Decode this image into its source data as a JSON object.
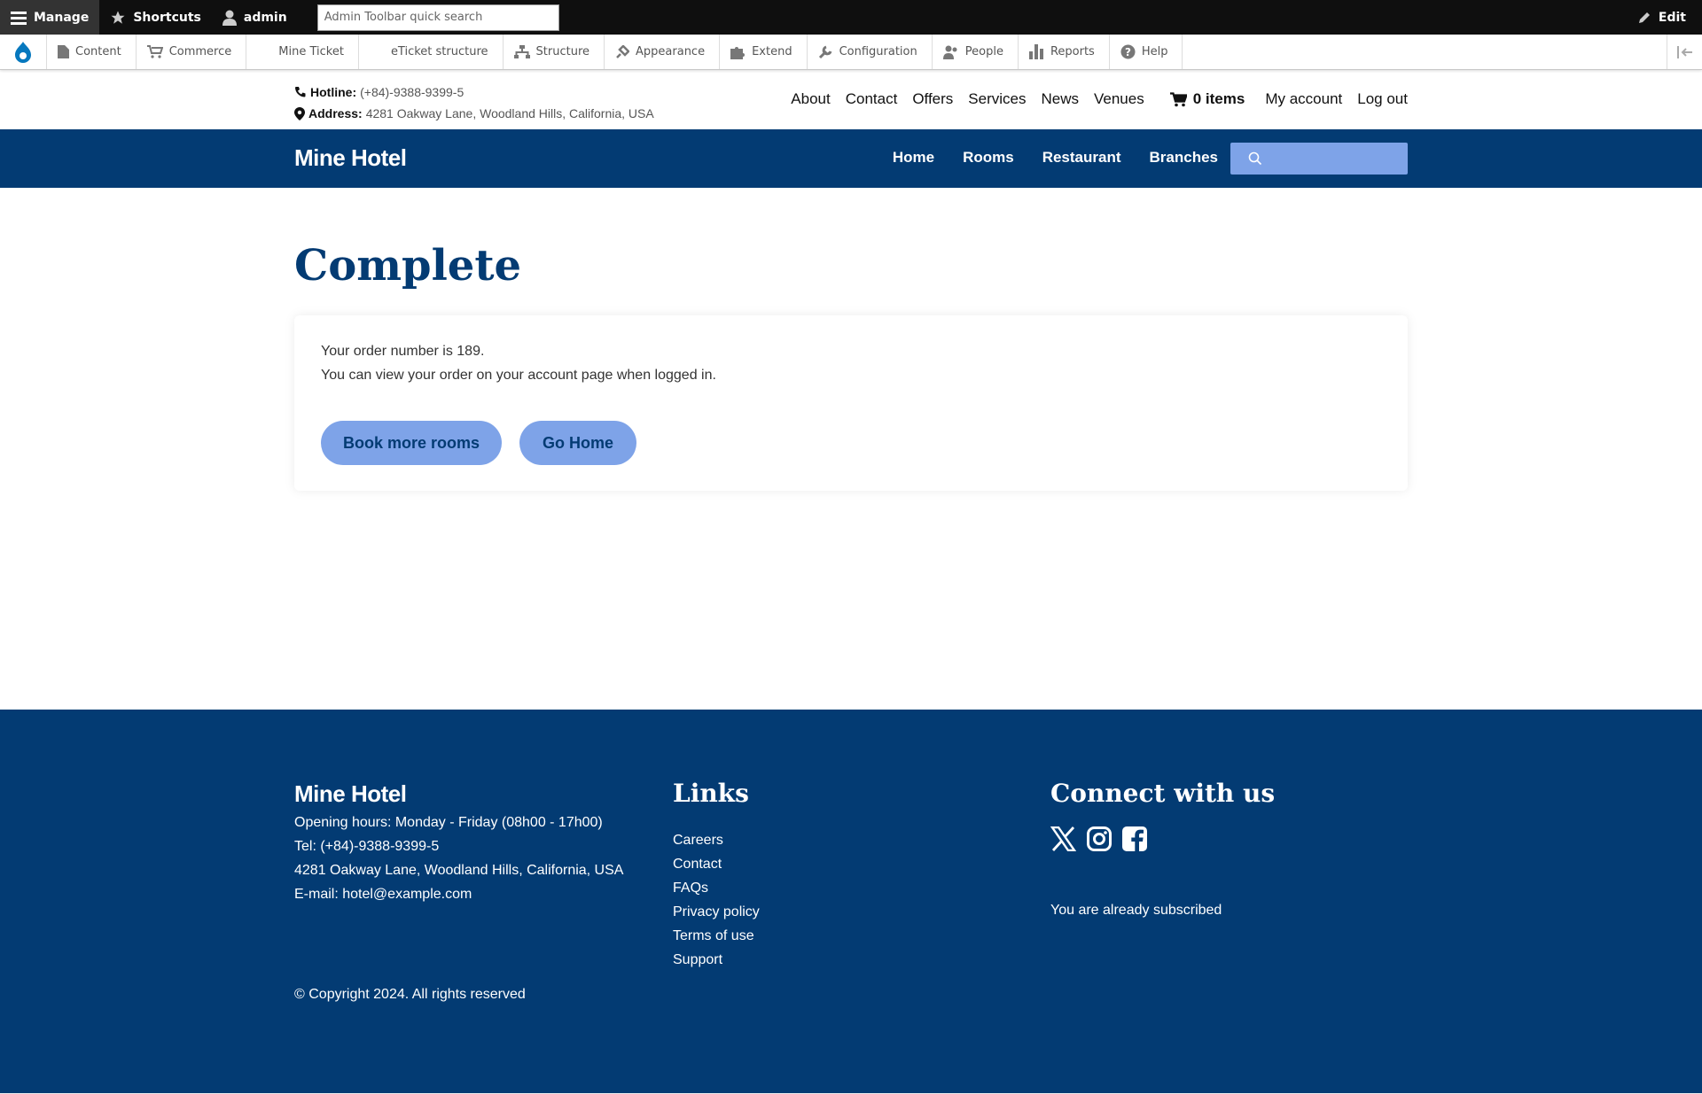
{
  "admin_toolbar": {
    "manage_label": "Manage",
    "shortcuts_label": "Shortcuts",
    "user_label": "admin",
    "search_placeholder": "Admin Toolbar quick search",
    "edit_label": "Edit"
  },
  "admin_tray": {
    "items": [
      {
        "label": "Content",
        "icon": "file-icon"
      },
      {
        "label": "Commerce",
        "icon": "cart-icon"
      },
      {
        "label": "Mine Ticket",
        "icon": ""
      },
      {
        "label": "eTicket structure",
        "icon": ""
      },
      {
        "label": "Structure",
        "icon": "sitemap-icon"
      },
      {
        "label": "Appearance",
        "icon": "brush-icon"
      },
      {
        "label": "Extend",
        "icon": "puzzle-icon"
      },
      {
        "label": "Configuration",
        "icon": "wrench-icon"
      },
      {
        "label": "People",
        "icon": "people-icon"
      },
      {
        "label": "Reports",
        "icon": "chart-icon"
      },
      {
        "label": "Help",
        "icon": "help-icon"
      }
    ]
  },
  "header": {
    "hotline_label": "Hotline:",
    "hotline_value": "(+84)-9388-9399-5",
    "address_label": "Address:",
    "address_value": "4281 Oakway Lane, Woodland Hills, California, USA",
    "top_links": [
      "About",
      "Contact",
      "Offers",
      "Services",
      "News",
      "Venues"
    ],
    "cart_label": "0 items",
    "account_link": "My account",
    "logout_link": "Log out"
  },
  "navbar": {
    "brand": "Mine Hotel",
    "items": [
      "Home",
      "Rooms",
      "Restaurant",
      "Branches"
    ],
    "search_placeholder": ""
  },
  "main": {
    "title": "Complete",
    "line1": "Your order number is 189.",
    "line2": "You can view your order on your account page when logged in.",
    "book_more_label": "Book more rooms",
    "go_home_label": "Go Home"
  },
  "footer": {
    "brand": "Mine Hotel",
    "opening_hours": "Opening hours: Monday - Friday (08h00 - 17h00)",
    "tel": "Tel: (+84)-9388-9399-5",
    "address": "4281 Oakway Lane, Woodland Hills, California, USA",
    "email": "E-mail: hotel@example.com",
    "links_heading": "Links",
    "links": [
      "Careers",
      "Contact",
      "FAQs",
      "Privacy policy",
      "Terms of use",
      "Support"
    ],
    "connect_heading": "Connect with us",
    "social_icons": [
      "x-icon",
      "instagram-icon",
      "facebook-icon"
    ],
    "subscribed_text": "You are already subscribed",
    "copyright": "© Copyright 2024. All rights reserved"
  },
  "colors": {
    "brand_blue": "#033b73",
    "button_blue": "#7ea3e8",
    "toolbar_black": "#0f0f0f"
  }
}
